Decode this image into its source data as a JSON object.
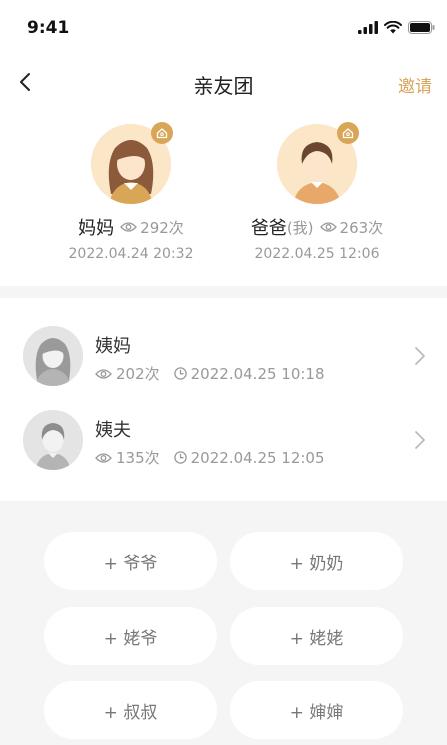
{
  "status_bar": {
    "time": "9:41"
  },
  "nav": {
    "title": "亲友团",
    "invite_label": "邀请"
  },
  "parents": [
    {
      "name": "妈妈",
      "me_tag": "",
      "views": "292次",
      "date": "2022.04.24 20:32"
    },
    {
      "name": "爸爸",
      "me_tag": "(我)",
      "views": "263次",
      "date": "2022.04.25 12:06"
    }
  ],
  "relatives": [
    {
      "name": "姨妈",
      "views": "202次",
      "time": "2022.04.25 10:18"
    },
    {
      "name": "姨夫",
      "views": "135次",
      "time": "2022.04.25 12:05"
    }
  ],
  "add_buttons": [
    "+ 爷爷",
    "+ 奶奶",
    "+ 姥爷",
    "+ 姥姥",
    "+ 叔叔",
    "+ 婶婶"
  ],
  "colors": {
    "accent": "#d7a55a",
    "text_secondary": "#999999",
    "background": "#f5f5f5"
  }
}
